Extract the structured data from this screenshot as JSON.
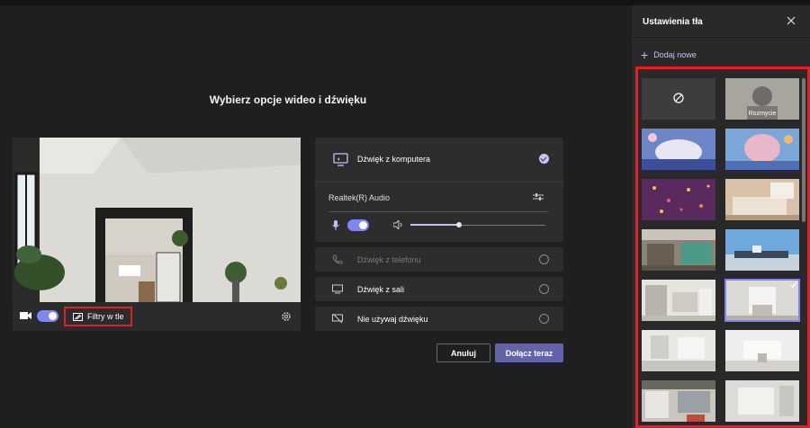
{
  "main": {
    "title": "Wybierz opcje wideo i dźwięku",
    "filters_label": "Filtry w tle"
  },
  "audio": {
    "computer_label": "Dźwięk z komputera",
    "device_label": "Realtek(R) Audio",
    "volume_level": 0.36,
    "phone_label": "Dźwięk z telefonu",
    "room_label": "Dźwięk z sali",
    "none_label": "Nie używaj dźwięku"
  },
  "actions": {
    "cancel_label": "Anuluj",
    "join_label": "Dołącz teraz"
  },
  "panel": {
    "title": "Ustawienia tła",
    "add_new_label": "Dodaj nowe",
    "blur_label": "Rozmycie"
  },
  "colors": {
    "accent": "#7f85f5",
    "primary_button": "#6264a7",
    "highlight_border": "#e01f26"
  }
}
